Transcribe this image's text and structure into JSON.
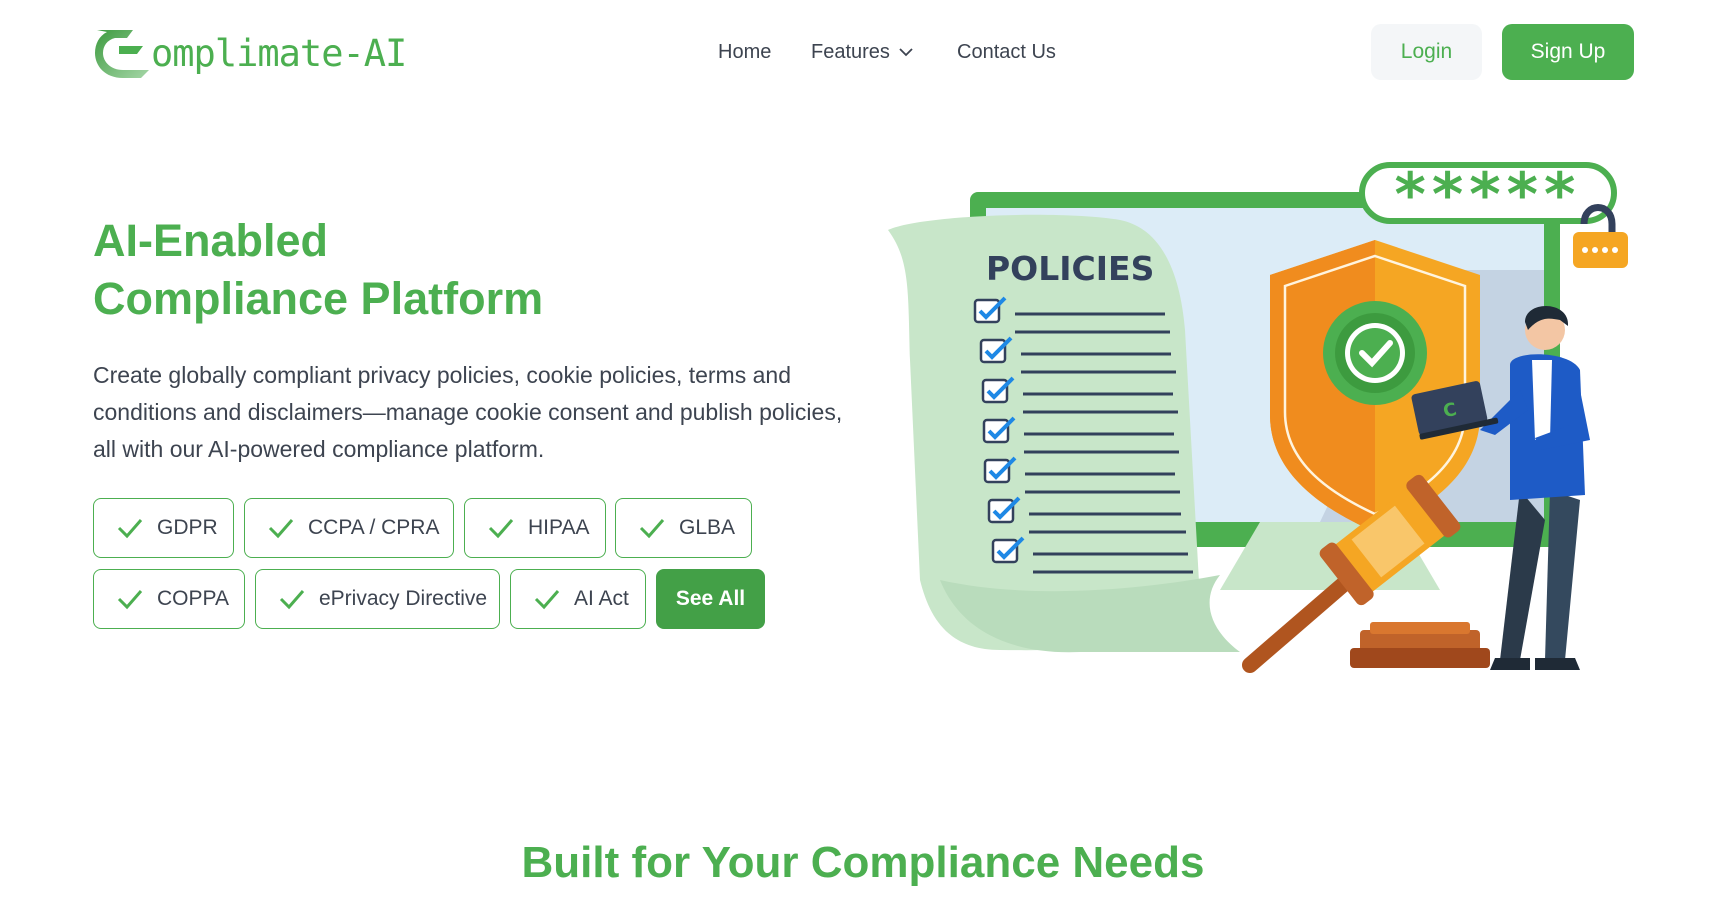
{
  "brand": {
    "name": "omplimate-AI",
    "color_primary": "#4caf50"
  },
  "nav": {
    "links": [
      {
        "label": "Home"
      },
      {
        "label": "Features"
      },
      {
        "label": "Contact Us"
      }
    ],
    "login_label": "Login",
    "signup_label": "Sign Up"
  },
  "hero": {
    "title_line1": "AI-Enabled",
    "title_line2": "Compliance Platform",
    "description": "Create globally compliant privacy policies, cookie policies, terms and conditions and disclaimers—manage cookie consent and publish policies, all with our AI-powered compliance platform.",
    "chips": [
      {
        "label": "GDPR"
      },
      {
        "label": "CCPA / CPRA"
      },
      {
        "label": "HIPAA"
      },
      {
        "label": "GLBA"
      },
      {
        "label": "COPPA"
      },
      {
        "label": "ePrivacy Directive"
      },
      {
        "label": "AI Act"
      }
    ],
    "see_all_label": "See All"
  },
  "illustration": {
    "document_title": "POLICIES",
    "password_mask": "*****",
    "icons": [
      "shield-check-icon",
      "gavel-icon",
      "padlock-icon",
      "laptop-icon"
    ]
  },
  "section": {
    "title": "Built for Your Compliance Needs"
  }
}
